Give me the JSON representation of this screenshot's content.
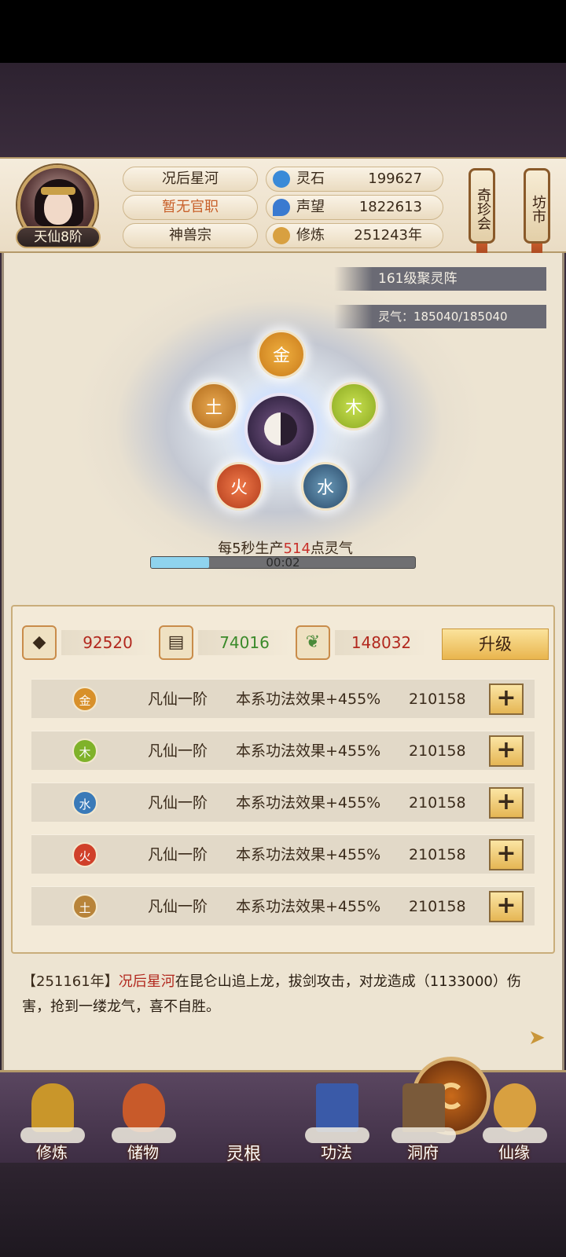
{
  "player": {
    "name": "况后星河",
    "title": "暂无官职",
    "sect": "神兽宗",
    "rank": "天仙8阶"
  },
  "resources": [
    {
      "label": "灵石",
      "value": "199627",
      "icon": "spirit-stone-icon",
      "color": "#3a8ad8"
    },
    {
      "label": "声望",
      "value": "1822613",
      "icon": "reputation-icon",
      "color": "#3a7ad0"
    },
    {
      "label": "修炼",
      "value": "251243年",
      "icon": "meditation-icon",
      "color": "#d8a040"
    }
  ],
  "side_buttons": {
    "treasure": "奇珍会",
    "market": "坊市"
  },
  "formation": {
    "name": "161级聚灵阵",
    "qi": "灵气：185040/185040",
    "production_prefix": "每5秒生产",
    "production_amount": "514",
    "production_suffix": "点灵气",
    "timer": "00:02",
    "progress": 0.22
  },
  "elements": [
    {
      "char": "金",
      "color": "#d8902a"
    },
    {
      "char": "木",
      "color": "#9ab830"
    },
    {
      "char": "水",
      "color": "#3a6a8a"
    },
    {
      "char": "火",
      "color": "#d04a2a"
    },
    {
      "char": "土",
      "color": "#c4862a"
    }
  ],
  "upgrade_costs": [
    {
      "icon": "ore-icon",
      "value": "92520",
      "color": "#b2281e"
    },
    {
      "icon": "wood-icon",
      "value": "74016",
      "color": "#3a8a2a"
    },
    {
      "icon": "herb-icon",
      "value": "148032",
      "color": "#b2281e"
    }
  ],
  "upgrade_label": "升级",
  "roots": [
    {
      "elem": "金",
      "tier": "凡仙一阶",
      "effect": "本系功法效果+455%",
      "value": "210158",
      "color": "#d8902a"
    },
    {
      "elem": "木",
      "tier": "凡仙一阶",
      "effect": "本系功法效果+455%",
      "value": "210158",
      "color": "#7fb22a"
    },
    {
      "elem": "水",
      "tier": "凡仙一阶",
      "effect": "本系功法效果+455%",
      "value": "210158",
      "color": "#3a7ab8"
    },
    {
      "elem": "火",
      "tier": "凡仙一阶",
      "effect": "本系功法效果+455%",
      "value": "210158",
      "color": "#d0402a"
    },
    {
      "elem": "土",
      "tier": "凡仙一阶",
      "effect": "本系功法效果+455%",
      "value": "210158",
      "color": "#b8843a"
    }
  ],
  "plus_label": "+",
  "log": {
    "year": "【251161年】",
    "name": "况后星河",
    "text": "在昆仑山追上龙，拔剑攻击，对龙造成（1133000）伤害，抢到一缕龙气，喜不自胜。"
  },
  "nav": [
    {
      "label": "修炼",
      "icon": "cultivate-icon",
      "color": "#c9962a"
    },
    {
      "label": "储物",
      "icon": "storage-bag-icon",
      "color": "#c85a2a"
    },
    {
      "label": "灵根",
      "icon": "spirit-root-icon",
      "color": "#c96a1a"
    },
    {
      "label": "功法",
      "icon": "manual-book-icon",
      "color": "#3a5aa8"
    },
    {
      "label": "洞府",
      "icon": "cave-house-icon",
      "color": "#7a5a3a"
    },
    {
      "label": "仙缘",
      "icon": "gourd-icon",
      "color": "#d8a040"
    }
  ]
}
